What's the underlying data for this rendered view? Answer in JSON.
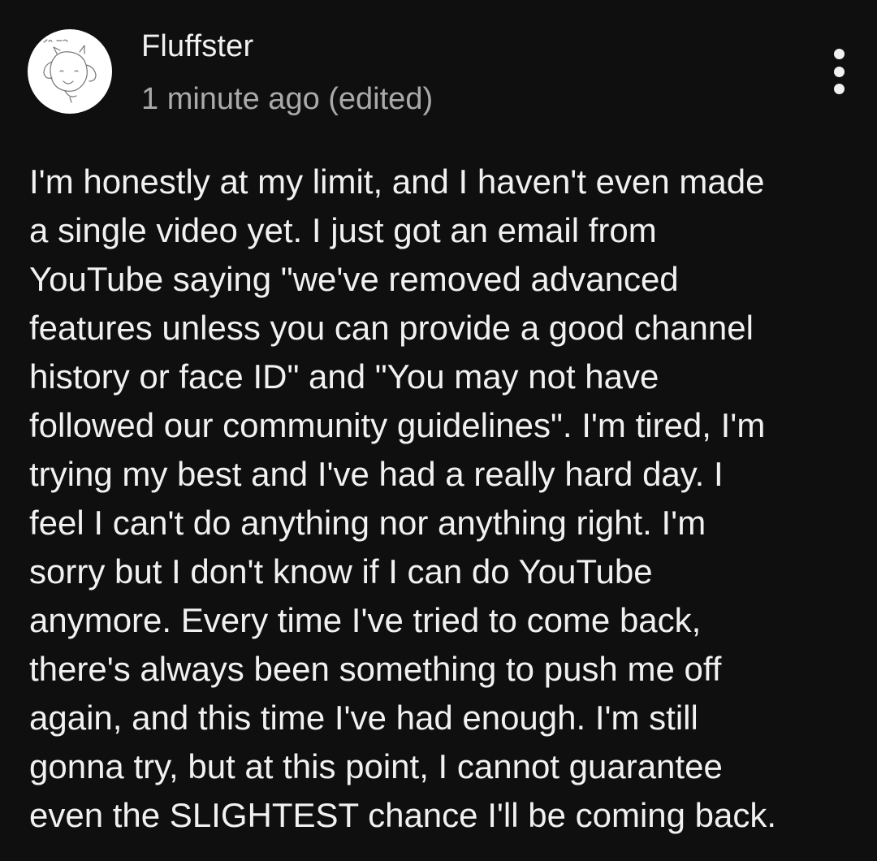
{
  "comment": {
    "author": "Fluffster",
    "timestamp": "1 minute ago (edited)",
    "avatar_label": "Fluffster avatar sketch",
    "more_icon": "three-dot-vertical-icon",
    "body_lines": [
      "I'm honestly at my limit, and I haven't even made",
      "a single video yet. I just got an email from",
      "YouTube saying \"we've removed advanced",
      "features unless you can provide a good channel",
      "history or face ID\" and \"You may not have",
      "followed our community guidelines\". I'm tired, I'm",
      "trying my best and I've had a really hard day. I",
      "feel I can't do anything nor anything right. I'm",
      "sorry but I don't know if I can do YouTube",
      "anymore. Every time I've tried to come back,",
      "there's always been something to push me off",
      "again, and this time I've had enough. I'm still",
      "gonna try, but at this point, I cannot guarantee",
      "even the SLIGHTEST chance I'll be coming back."
    ]
  },
  "colors": {
    "background": "#0f0f0f",
    "primary_text": "#f1f1f1",
    "secondary_text": "#aaaaaa",
    "avatar_bg": "#ffffff"
  }
}
